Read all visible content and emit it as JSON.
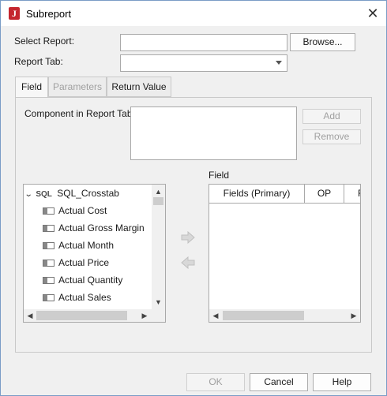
{
  "window": {
    "title": "Subreport",
    "close_glyph": "✕",
    "app_icon_letter": "J"
  },
  "form": {
    "select_report_label": "Select Report:",
    "select_report_value": "",
    "browse_label": "Browse...",
    "report_tab_label": "Report Tab:",
    "report_tab_value": ""
  },
  "tabs": [
    {
      "label": "Field",
      "state": "active"
    },
    {
      "label": "Parameters",
      "state": "disabled"
    },
    {
      "label": "Return Value",
      "state": "normal"
    }
  ],
  "field_tab": {
    "component_label": "Component in Report Tab:",
    "add_label": "Add",
    "remove_label": "Remove",
    "field_label": "Field",
    "tree": {
      "root": {
        "icon": "sql-icon",
        "icon_text": "SQL",
        "label": "SQL_Crosstab",
        "expanded": true
      },
      "items": [
        "Actual Cost",
        "Actual Gross Margin",
        "Actual Month",
        "Actual Price",
        "Actual Quantity",
        "Actual Sales"
      ]
    },
    "table_columns": [
      "Fields (Primary)",
      "OP",
      "F"
    ]
  },
  "footer": {
    "ok_label": "OK",
    "cancel_label": "Cancel",
    "help_label": "Help"
  },
  "colors": {
    "accent_border": "#7a9cc6",
    "app_icon": "#c4262e",
    "disabled_text": "#a0a0a0"
  }
}
